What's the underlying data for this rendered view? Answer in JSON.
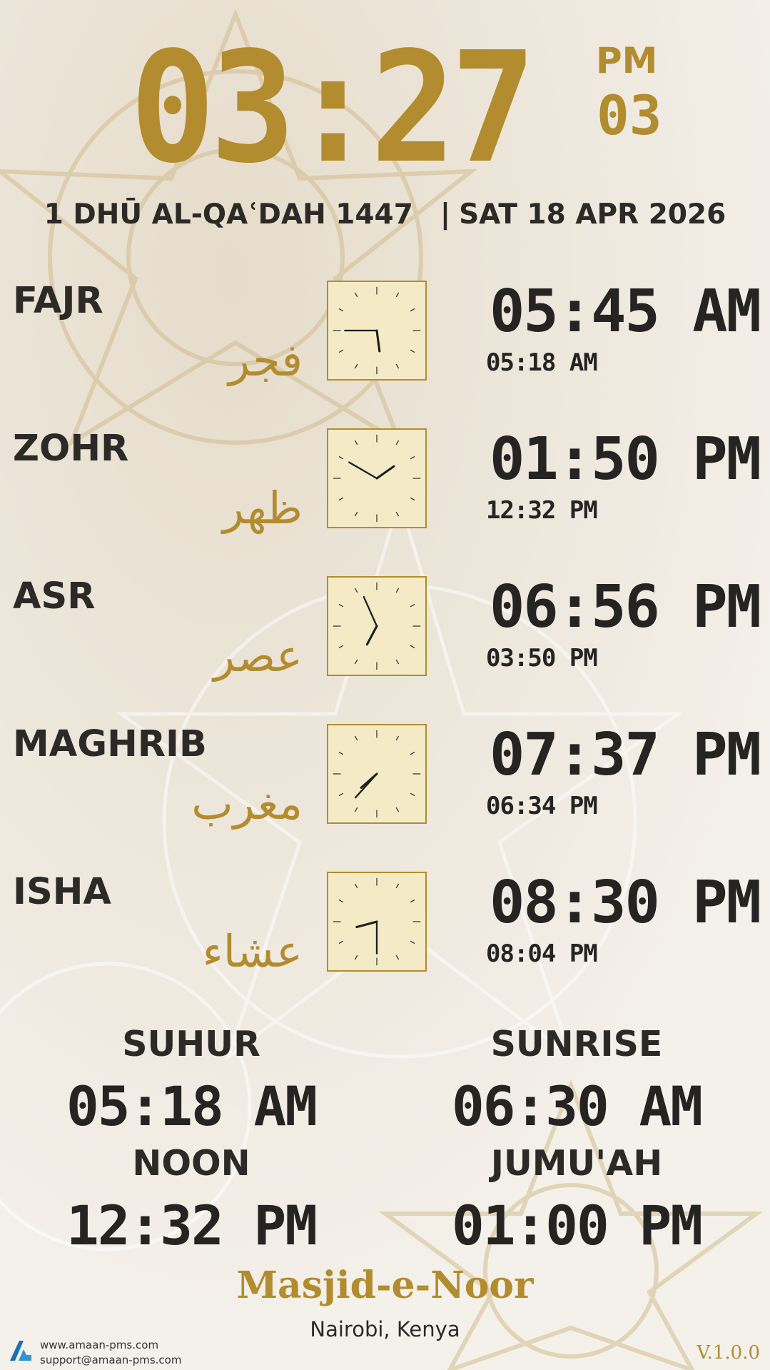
{
  "clock": {
    "time": "03:27",
    "period": "PM",
    "seconds": "03"
  },
  "date": {
    "hijri": "1 DHŪ AL-QAʿDAH 1447",
    "separator": "|",
    "gregorian": "SAT 18 APR 2026"
  },
  "prayers": [
    {
      "name": "FAJR",
      "arabic": "فجر",
      "iqamah": "05:45 AM",
      "adhan": "05:18 AM"
    },
    {
      "name": "ZOHR",
      "arabic": "ظهر",
      "iqamah": "01:50 PM",
      "adhan": "12:32 PM"
    },
    {
      "name": "ASR",
      "arabic": "عصر",
      "iqamah": "06:56 PM",
      "adhan": "03:50 PM"
    },
    {
      "name": "MAGHRIB",
      "arabic": "مغرب",
      "iqamah": "07:37 PM",
      "adhan": "06:34 PM"
    },
    {
      "name": "ISHA",
      "arabic": "عشاء",
      "iqamah": "08:30 PM",
      "adhan": "08:04 PM"
    }
  ],
  "summary": {
    "suhur": {
      "label": "SUHUR",
      "time": "05:18 AM"
    },
    "sunrise": {
      "label": "SUNRISE",
      "time": "06:30 AM"
    },
    "noon": {
      "label": "NOON",
      "time": "12:32 PM"
    },
    "jumuah": {
      "label": "JUMU'AH",
      "time": "01:00 PM"
    }
  },
  "masjid": {
    "name": "Masjid-e-Noor",
    "location": "Nairobi, Kenya"
  },
  "footer": {
    "website": "www.amaan-pms.com",
    "email": "support@amaan-pms.com",
    "version": "V.1.0.0"
  },
  "colors": {
    "gold": "#b28c2e",
    "text": "#2c2a27",
    "clock_face": "#f4ebc6",
    "background": "#f1ece3"
  },
  "icons": {
    "logo": "amaan-logo-icon",
    "analog_clock": "analog-clock-icon"
  }
}
